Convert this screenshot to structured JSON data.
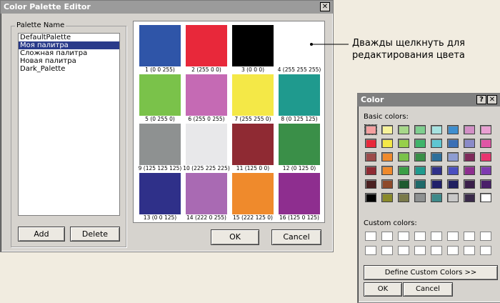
{
  "editor": {
    "title": "Color Palette Editor",
    "close_glyph": "✕",
    "palette_group_label": "Palette Name",
    "palettes": [
      "DefaultPalette",
      "Моя палитра",
      "Сложная палитра",
      "Новая палитра",
      "Dark_Palette"
    ],
    "selected_palette_index": 1,
    "add_label": "Add",
    "delete_label": "Delete",
    "ok_label": "OK",
    "cancel_label": "Cancel",
    "swatches": [
      {
        "color": "#2f55a8",
        "label": "1 (0 0 255)"
      },
      {
        "color": "#e8283a",
        "label": "2 (255 0 0)"
      },
      {
        "color": "#000000",
        "label": "3 (0 0 0)"
      },
      {
        "color": "#ffffff",
        "label": "4 (255 255 255)"
      },
      {
        "color": "#7ac24a",
        "label": "5 (0 255 0)"
      },
      {
        "color": "#c56ab4",
        "label": "6 (255 0 255)"
      },
      {
        "color": "#f4e847",
        "label": "7 (255 255 0)"
      },
      {
        "color": "#1f9a8e",
        "label": "8 (0 125 125)"
      },
      {
        "color": "#8e9191",
        "label": "9 (125 125 125)"
      },
      {
        "color": "#e8e8ea",
        "label": "10 (225 225 225)"
      },
      {
        "color": "#8f2a33",
        "label": "11 (125 0 0)"
      },
      {
        "color": "#3a8f48",
        "label": "12 (0 125 0)"
      },
      {
        "color": "#2f3089",
        "label": "13 (0 0 125)"
      },
      {
        "color": "#a96ab3",
        "label": "14 (222 0 255)"
      },
      {
        "color": "#ef8a2c",
        "label": "15 (222 125 0)"
      },
      {
        "color": "#8e2e8f",
        "label": "16 (125 0 125)"
      }
    ]
  },
  "annotation": {
    "text_line1": "Дважды щелкнуть для",
    "text_line2": "редактирования цвета"
  },
  "color_dialog": {
    "title": "Color",
    "help_glyph": "?",
    "close_glyph": "✕",
    "basic_label": "Basic colors:",
    "custom_label": "Custom colors:",
    "define_label": "Define Custom Colors >>",
    "ok_label": "OK",
    "cancel_label": "Cancel",
    "basic_colors": [
      "#f4a0a0",
      "#f6f29a",
      "#a7d88a",
      "#7fcf8f",
      "#a6e2e0",
      "#3e8ecf",
      "#d38fc6",
      "#e9a0d2",
      "#e8283a",
      "#f4e847",
      "#97cf4a",
      "#3fb46a",
      "#5ec6d2",
      "#3a6fb5",
      "#8a8ac8",
      "#e055a5",
      "#9c4b4b",
      "#ef8a2c",
      "#7ac24a",
      "#3a8f48",
      "#2d6f9a",
      "#8e9dd2",
      "#7e2a5a",
      "#e8356f",
      "#8f2a33",
      "#ef8a2c",
      "#3a9e45",
      "#1f9a8e",
      "#2f3089",
      "#4a4fc0",
      "#8e2e8f",
      "#7e3ab0",
      "#4a2020",
      "#8e4a2a",
      "#1f5a2f",
      "#1f6a6a",
      "#20206a",
      "#202060",
      "#3a1f4a",
      "#4a1f6a",
      "#000000",
      "#8a8a2a",
      "#7a7a4a",
      "#8e9191",
      "#3e8a8a",
      "#c8c8c8",
      "#3a2a4a",
      "#ffffff"
    ]
  }
}
